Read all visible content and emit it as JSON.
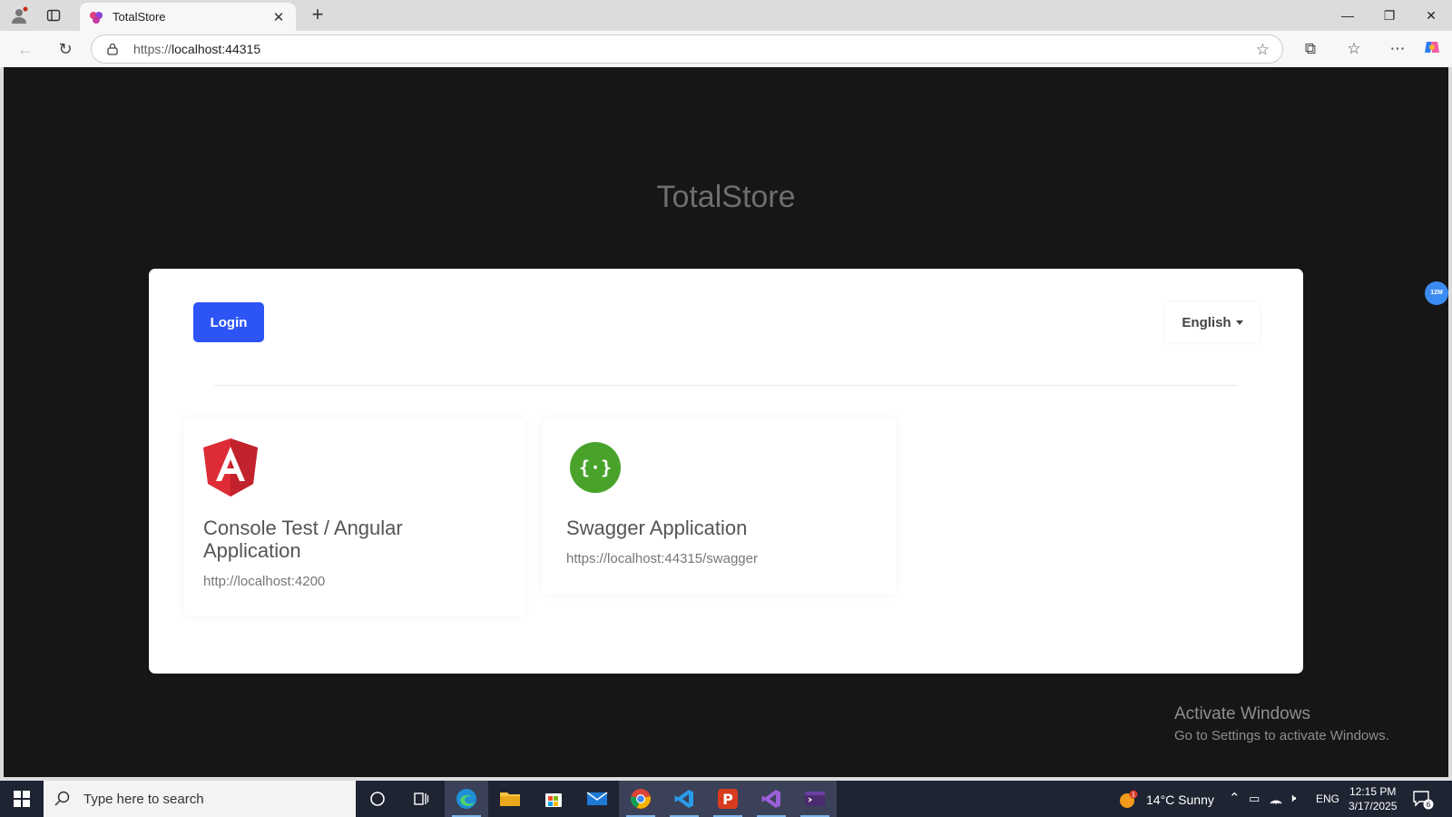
{
  "browser": {
    "tab_title": "TotalStore",
    "url_prefix": "https://",
    "url_host": "localhost:44315"
  },
  "page": {
    "site_title": "TotalStore",
    "login_label": "Login",
    "language_label": "English",
    "apps": [
      {
        "name": "Console Test / Angular Application",
        "url": "http://localhost:4200",
        "icon": "angular-logo-icon"
      },
      {
        "name": "Swagger Application",
        "url": "https://localhost:44315/swagger",
        "icon": "swagger-logo-icon"
      }
    ],
    "side_badge": "12M"
  },
  "watermark": {
    "line1": "Activate Windows",
    "line2": "Go to Settings to activate Windows."
  },
  "taskbar": {
    "search_placeholder": "Type here to search",
    "weather": "14°C  Sunny",
    "weather_badge": "1",
    "language": "ENG",
    "time": "12:15 PM",
    "date": "3/17/2025",
    "notification_count": "6"
  }
}
